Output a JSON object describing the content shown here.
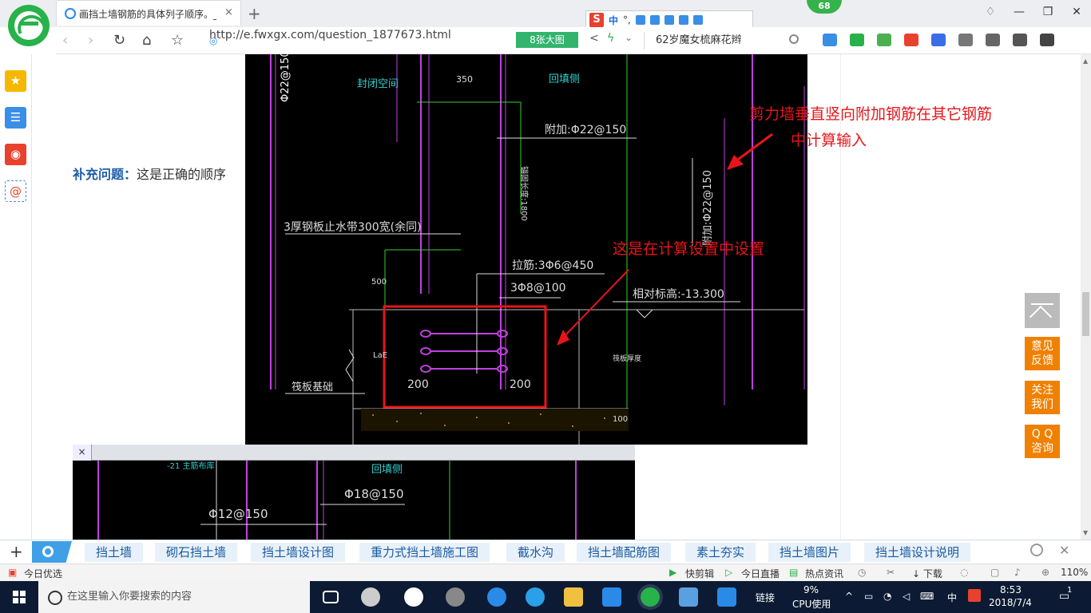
{
  "browser": {
    "tab_title": "画挡土墙钢筋的具体列子顺序。_",
    "tab_close": "×",
    "new_tab": "+",
    "badge_count": "68",
    "url": "http://e.fwxgx.com/question_1877673.html",
    "big_image_btn": "8张大图",
    "search_text": "62岁魔女梳麻花辫",
    "ime_label": "中"
  },
  "content": {
    "supplement_label": "补充问题：",
    "supplement_text": "这是正确的顺序",
    "note_shear_wall_line1": "剪力墙垂直竖向附加钢筋在其它钢筋",
    "note_shear_wall_line2": "中计算输入",
    "note_calc_setting": "这是在计算设置中设置"
  },
  "cad_labels": {
    "phi22_150_top": "Φ22@150",
    "closed_space": "封闭空间",
    "backfill_side": "回填侧",
    "dim_350": "350",
    "add_phi22": "附加:Φ22@150",
    "anchor_len": "锚固长度:1800",
    "add_phi22_vert": "附加:Φ22@150",
    "steel_plate": "3厚钢板止水带300宽(余同)",
    "tie_bars": "拉筋:3Φ6@450",
    "dim_500": "500",
    "three_phi8": "3Φ8@100",
    "relative_elev": "相对标高:-13.300",
    "lae": "LaE",
    "raft_foundation": "筏板基础",
    "dim_200_left": "200",
    "dim_200_right": "200",
    "raft_thickness": "筏板厚度",
    "dim_100": "100"
  },
  "cad2": {
    "tab_close": "×",
    "top_text": "-21 主筋布库",
    "backfill_side": "回填侧",
    "phi12": "Φ12@150",
    "phi18": "Φ18@150"
  },
  "float_buttons": {
    "feedback": "意见\n反馈",
    "follow": "关注\n我们",
    "qq": "Q Q\n咨询"
  },
  "tags": [
    "挡土墙",
    "砌石挡土墙",
    "挡土墙设计图",
    "重力式挡土墙施工图",
    "截水沟",
    "挡土墙配筋图",
    "素土夯实",
    "挡土墙图片",
    "挡土墙设计说明"
  ],
  "statusbar": {
    "today_pick": "今日优选",
    "quick_clip": "快剪辑",
    "live": "今日直播",
    "hot_news": "热点资讯",
    "download": "下载",
    "zoom": "110%"
  },
  "taskbar": {
    "search_placeholder": "在这里输入你要搜索的内容",
    "link": "链接",
    "cpu_percent": "9%",
    "cpu_label": "CPU使用",
    "ime": "中",
    "time": "8:53",
    "date": "2018/7/4",
    "notif_count": "1"
  },
  "colors": {
    "accent_green": "#27b24a",
    "float_orange": "#f08000",
    "tag_blue": "#1a5aa0",
    "annotation_red": "#e8141a"
  }
}
